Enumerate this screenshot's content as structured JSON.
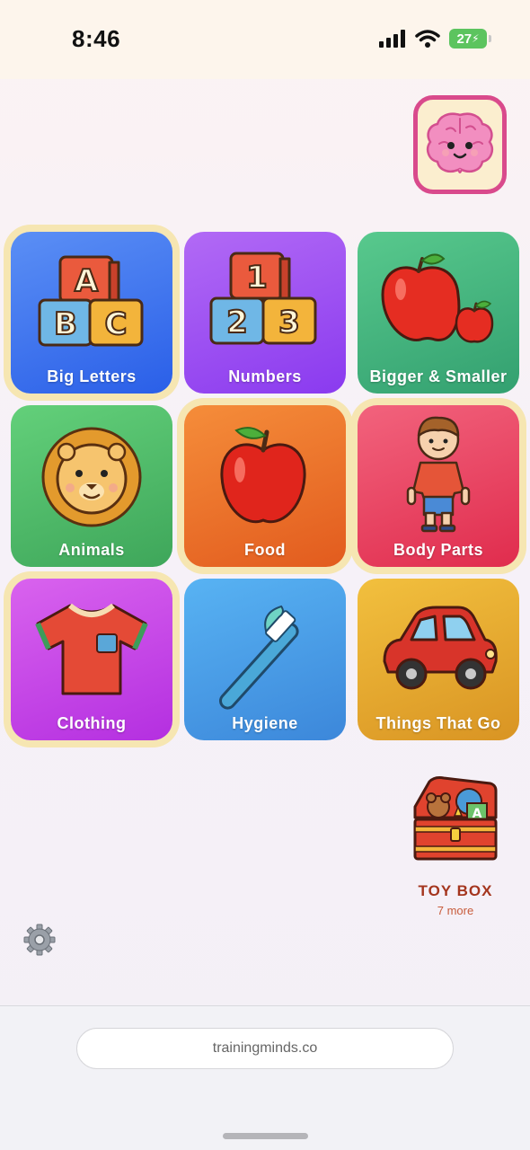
{
  "status_bar": {
    "time": "8:46",
    "battery": "27"
  },
  "tiles": [
    {
      "label": "Big Letters",
      "color_top": "#5b8ff5",
      "color_bottom": "#2a5fe8"
    },
    {
      "label": "Numbers",
      "color_top": "#b26af5",
      "color_bottom": "#8a3aef"
    },
    {
      "label": "Bigger & Smaller",
      "color_top": "#58c98d",
      "color_bottom": "#33a070"
    },
    {
      "label": "Animals",
      "color_top": "#63d07a",
      "color_bottom": "#3ea65a"
    },
    {
      "label": "Food",
      "color_top": "#f58d3a",
      "color_bottom": "#e25b1e"
    },
    {
      "label": "Body Parts",
      "color_top": "#f2637d",
      "color_bottom": "#e02c4d"
    },
    {
      "label": "Clothing",
      "color_top": "#d963ee",
      "color_bottom": "#b42fe0"
    },
    {
      "label": "Hygiene",
      "color_top": "#58b3f3",
      "color_bottom": "#3c87da"
    },
    {
      "label": "Things That Go",
      "color_top": "#f2c03e",
      "color_bottom": "#d99423"
    }
  ],
  "toybox": {
    "title": "TOY BOX",
    "subtitle": "7 more"
  },
  "browser": {
    "url": "trainingminds.co"
  },
  "icons": {
    "brain": "brain-mascot-icon",
    "settings": "gear-icon",
    "toybox": "toy-chest-icon"
  }
}
